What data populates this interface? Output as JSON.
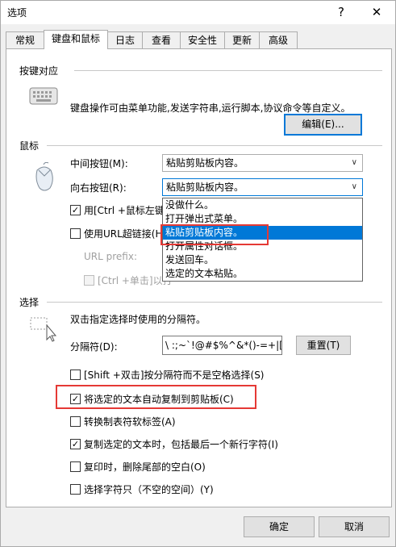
{
  "window": {
    "title": "选项",
    "help_glyph": "?",
    "close_glyph": "✕"
  },
  "tabs": [
    "常规",
    "键盘和鼠标",
    "日志",
    "查看",
    "安全性",
    "更新",
    "高级"
  ],
  "active_tab": "键盘和鼠标",
  "keyboard": {
    "section_title": "按键对应",
    "description": "键盘操作可由菜单功能,发送字符串,运行脚本,协议命令等自定义。",
    "edit_button": "编辑(E)..."
  },
  "mouse": {
    "section_title": "鼠标",
    "middle_label": "中间按钮(M):",
    "middle_value": "粘贴剪贴板内容。",
    "right_label": "向右按钮(R):",
    "right_value": "粘贴剪贴板内容。",
    "right_options": [
      "没做什么。",
      "打开弹出式菜单。",
      "粘贴剪贴板内容。",
      "打开属性对话框。",
      "发送回车。",
      "选定的文本粘贴。"
    ],
    "right_selected_index": 2,
    "ctrl_left_label": "用[Ctrl +鼠标左键",
    "ctrl_left_checked": true,
    "url_hyperlink_label": "使用URL超链接(H",
    "url_hyperlink_checked": false,
    "url_prefix_label": "URL prefix:",
    "ctrl_click_label": "[Ctrl +单击]以打",
    "ctrl_click_checked": false
  },
  "selection": {
    "section_title": "选择",
    "description": "双击指定选择时使用的分隔符。",
    "delimiter_label": "分隔符(D):",
    "delimiter_value": "\\ :;~`!@#$%^&*()-=+|[",
    "reset_button": "重置(T)",
    "checkboxes": [
      {
        "label": "[Shift +双击]按分隔符而不是空格选择(S)",
        "checked": false
      },
      {
        "label": "将选定的文本自动复制到剪贴板(C)",
        "checked": true
      },
      {
        "label": "转换制表符软标签(A)",
        "checked": false
      },
      {
        "label": "复制选定的文本时，包括最后一个新行字符(I)",
        "checked": true
      },
      {
        "label": "复印时，删除尾部的空白(O)",
        "checked": false
      },
      {
        "label": "选择字符只（不空的空间）(Y)",
        "checked": false
      }
    ]
  },
  "footer": {
    "ok_button": "确定",
    "cancel_button": "取消"
  },
  "icons": {
    "keyboard": "keyboard-icon",
    "mouse": "mouse-icon",
    "selection": "selection-cursor-icon"
  },
  "colors": {
    "accent": "#0078d7",
    "highlight_box": "#e53935"
  }
}
